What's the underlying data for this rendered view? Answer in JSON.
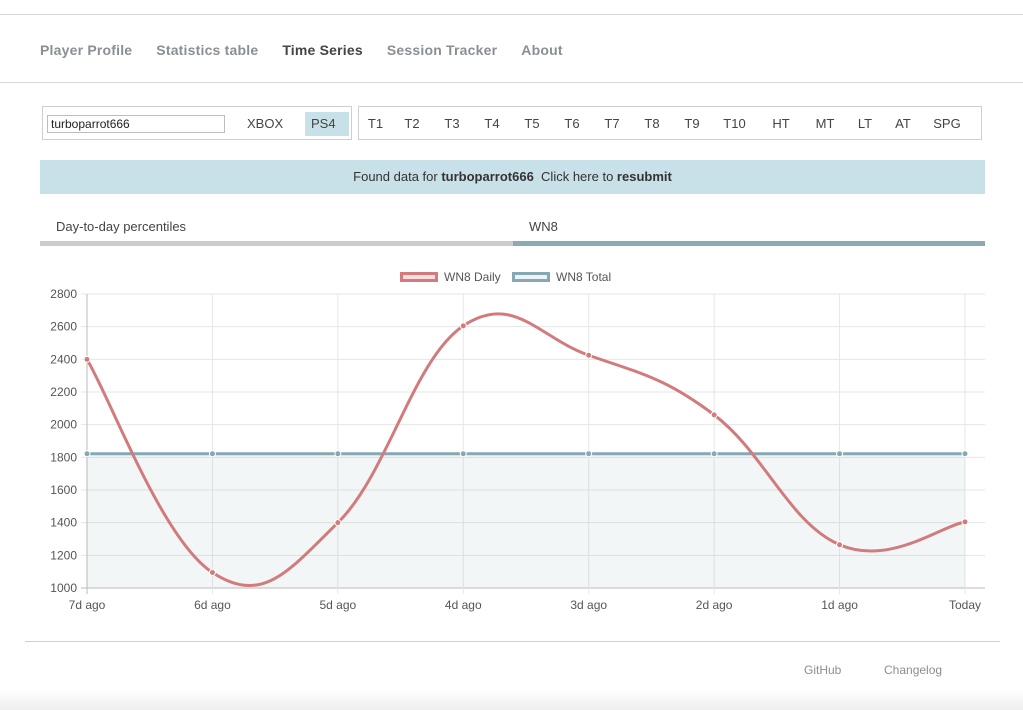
{
  "nav": {
    "items": [
      "Player Profile",
      "Statistics table",
      "Time Series",
      "Session Tracker",
      "About"
    ],
    "active": "Time Series"
  },
  "search": {
    "value": "turboparrot666"
  },
  "platforms": {
    "items": [
      "XBOX",
      "PS4"
    ],
    "selected": "PS4"
  },
  "tiers": [
    "T1",
    "T2",
    "T3",
    "T4",
    "T5",
    "T6",
    "T7",
    "T8",
    "T9",
    "T10",
    "HT",
    "MT",
    "LT",
    "AT",
    "SPG"
  ],
  "banner": {
    "prefix": "Found data for",
    "player": "turboparrot666",
    "middle": "Click here to",
    "action": "resubmit"
  },
  "tabs": [
    {
      "label": "Day-to-day percentiles",
      "active": false
    },
    {
      "label": "WN8",
      "active": true
    }
  ],
  "chart_data": {
    "type": "line",
    "x": [
      "7d ago",
      "6d ago",
      "5d ago",
      "4d ago",
      "3d ago",
      "2d ago",
      "1d ago",
      "Today"
    ],
    "series": [
      {
        "name": "WN8 Daily",
        "values": [
          2400,
          1095,
          1400,
          2605,
          2425,
          2060,
          1265,
          1405
        ],
        "color": "#d27b7d",
        "fill": false
      },
      {
        "name": "WN8 Total",
        "values": [
          1822,
          1822,
          1822,
          1822,
          1822,
          1822,
          1822,
          1822
        ],
        "color": "#85a8b4",
        "fill": true
      }
    ],
    "ylim": [
      1000,
      2800
    ],
    "yticks": [
      1000,
      1200,
      1400,
      1600,
      1800,
      2000,
      2200,
      2400,
      2600,
      2800
    ],
    "grid": true,
    "legend": "top-center"
  },
  "footer": {
    "links": [
      "GitHub",
      "Changelog"
    ]
  }
}
